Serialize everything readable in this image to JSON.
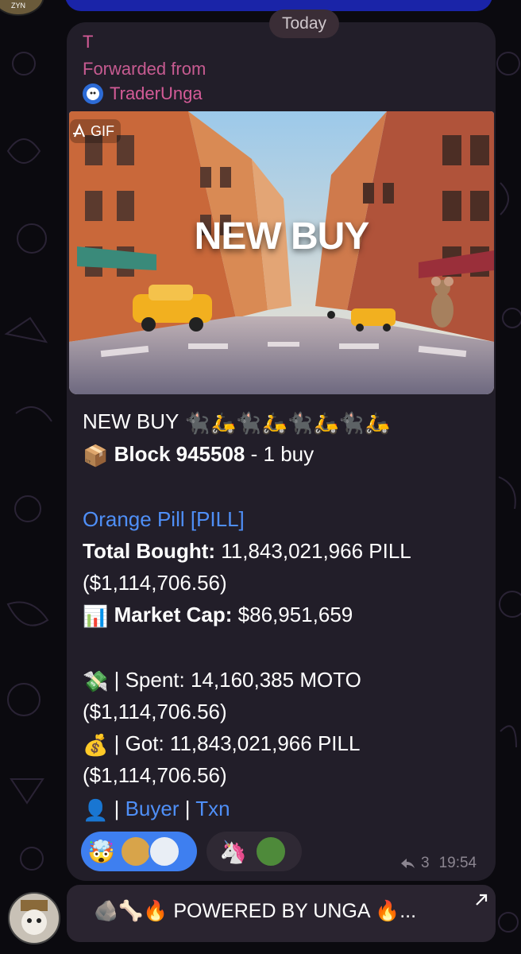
{
  "date_separator": "Today",
  "message": {
    "sender": "T",
    "forwarded_label": "Forwarded from",
    "forwarded_channel": "TraderUnga",
    "media": {
      "badge": "GIF",
      "overlay_text": "NEW BUY"
    },
    "headline": "NEW BUY",
    "headline_emoji": "🐈‍⬛🛵🐈‍⬛🛵🐈‍⬛🛵🐈‍⬛🛵",
    "block": {
      "emoji": "📦",
      "label": "Block 945508",
      "suffix": " - 1 buy"
    },
    "token_link": "Orange Pill [PILL]",
    "total_bought": {
      "label": "Total Bought:",
      "value": " 11,843,021,966 PILL",
      "usd": "($1,114,706.56)"
    },
    "market_cap": {
      "emoji": "📊",
      "label": "Market Cap:",
      "value": " $86,951,659"
    },
    "spent": {
      "emoji": "💸",
      "text": " | Spent: 14,160,385 MOTO",
      "usd": "($1,114,706.56)"
    },
    "got": {
      "emoji": "💰",
      "text": " | Got: 11,843,021,966 PILL",
      "usd": "($1,114,706.56)"
    },
    "links": {
      "emoji": "👤",
      "sep1": " | ",
      "buyer": "Buyer",
      "sep2": " | ",
      "txn": "Txn"
    },
    "reactions": [
      {
        "emoji": "🤯",
        "active": true
      },
      {
        "emoji": "🦄",
        "active": false
      }
    ],
    "reply_count": "3",
    "time": "19:54"
  },
  "inline_button": {
    "label": "🪨🦴🔥 POWERED BY UNGA 🔥..."
  },
  "top_avatar_label": "ZYN",
  "colors": {
    "background": "#0b0a0f",
    "bubble": "#221e29",
    "sender_pink": "#d45b97",
    "link_blue": "#4f8ff7",
    "reaction_active": "#3e7ff0",
    "inline_button": "#2a2430"
  }
}
